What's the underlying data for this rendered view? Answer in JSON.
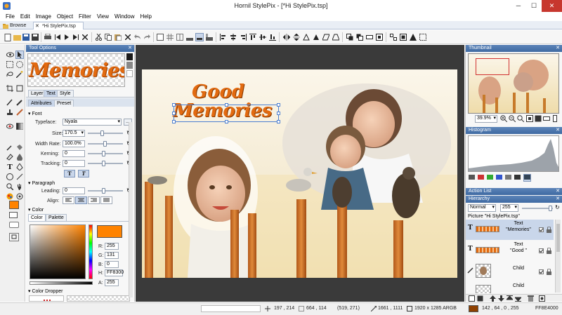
{
  "window": {
    "title": "Hornil StylePix - [*Hi StylePix.tsp]",
    "min": "─",
    "max": "☐",
    "close": "✕"
  },
  "menu": [
    "File",
    "Edit",
    "Image",
    "Object",
    "Filter",
    "View",
    "Window",
    "Help"
  ],
  "tabs": [
    "Browse",
    "*Hi StylePix.tsp"
  ],
  "tool_options": {
    "title": "Tool Options",
    "preview_text": "Memories",
    "subtabs": [
      "Layer",
      "Text",
      "Style"
    ],
    "subtabs2": [
      "Attributes",
      "Preset"
    ],
    "font": {
      "section": "Font",
      "typeface_label": "Typeface:",
      "typeface": "Nyala",
      "size_label": "Size:",
      "size": "170.5",
      "width_label": "Width Rate:",
      "width": "100.0%",
      "kerning_label": "Kerning:",
      "kerning": "0",
      "tracking_label": "Tracking:",
      "tracking": "0",
      "more_btn": "..."
    },
    "paragraph": {
      "section": "Paragraph",
      "leading_label": "Leading:",
      "leading": "0",
      "align_label": "Align:"
    },
    "color": {
      "section": "Color",
      "tabs": [
        "Color",
        "Palette"
      ],
      "R_label": "R:",
      "R": "255",
      "G_label": "G:",
      "G": "131",
      "B_label": "B:",
      "B": "0",
      "H_label": "H:",
      "H": "FF8300",
      "A_label": "A:",
      "A": "255",
      "swatch": "#ff8300"
    },
    "dropper": {
      "section": "Color Dropper"
    }
  },
  "canvas": {
    "text1": "Good",
    "text2": "Memories"
  },
  "thumbnail": {
    "title": "Thumbnail",
    "zoom": "39.9%"
  },
  "histogram": {
    "title": "Histogram"
  },
  "action_list": {
    "title": "Action List"
  },
  "hierarchy": {
    "title": "Hierarchy",
    "blend": "Normal",
    "opacity": "255",
    "root": "Picture \"Hi StylePix.tsp\"",
    "items": [
      {
        "type": "Text",
        "name": "\"Memories\""
      },
      {
        "type": "Text",
        "name": "\"Good \""
      },
      {
        "type": "Child",
        "name": ""
      },
      {
        "type": "Child",
        "name": ""
      }
    ]
  },
  "status": {
    "coords1": "197 , 214",
    "coords2": "664 , 114",
    "pos": "(519, 271)",
    "size": "1661 , 1111",
    "image": "1920 x 1285 ARGB",
    "color": "142 , 64 , 0 , 255",
    "hex": "FF8E4000",
    "swatch": "#8e4000"
  }
}
